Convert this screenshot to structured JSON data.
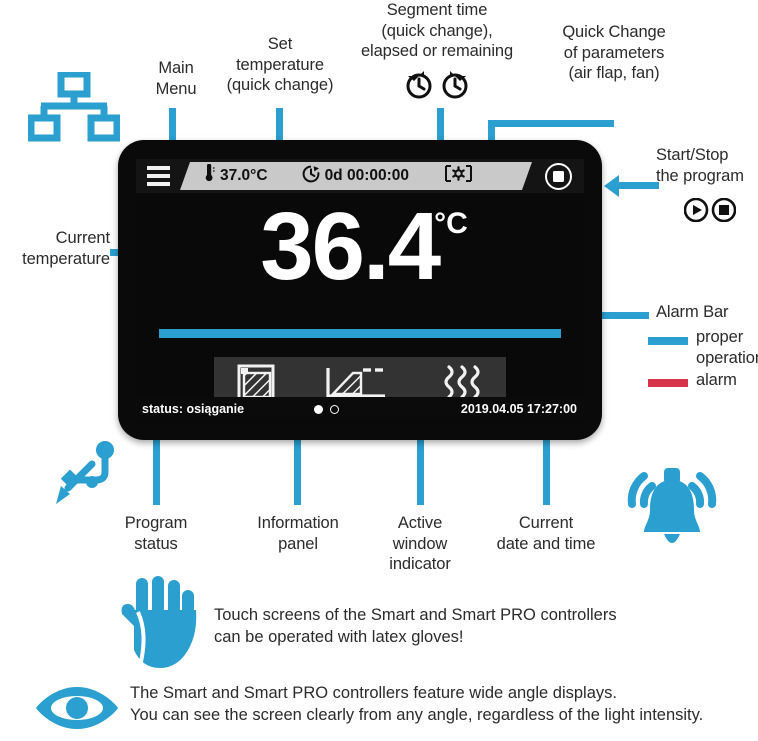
{
  "callouts": {
    "main_menu": "Main\nMenu",
    "set_temperature": "Set\ntemperature\n(quick change)",
    "segment_time": "Segment time\n(quick change),\nelapsed or remaining",
    "quick_change_params": "Quick Change\nof parameters\n(air flap, fan)",
    "start_stop": "Start/Stop\nthe program",
    "current_temperature": "Current\ntemperature",
    "alarm_bar": "Alarm Bar",
    "alarm_proper": "proper\noperation",
    "alarm_alarm": "alarm",
    "program_status": "Program\nstatus",
    "information_panel": "Information\npanel",
    "active_window_indicator": "Active\nwindow\nindicator",
    "current_date_time": "Current\ndate and time"
  },
  "device": {
    "quick_bar": {
      "set_temperature_value": "37.0°C",
      "segment_time_value": "0d 00:00:00"
    },
    "main_reading": {
      "value": "36.4",
      "unit": "°C"
    },
    "status_bar": {
      "program_status": "status: osiąganie",
      "datetime": "2019.04.05 17:27:00"
    },
    "info_panel_icons": [
      "chamber-icon",
      "program-chart-icon",
      "heating-waves-icon"
    ],
    "active_window": {
      "total": 2,
      "active_index": 0
    }
  },
  "notes": {
    "gloves": "Touch screens of the Smart and Smart PRO controllers\ncan be operated with latex gloves!",
    "viewing_angle": "The Smart  and Smart PRO controllers feature wide angle displays.\nYou can see the screen clearly from any angle, regardless of the light intensity."
  },
  "colors": {
    "accent": "#2a9fd0",
    "alarm": "#d7334a",
    "screen_bg": "#090909",
    "quick_strip": "#c9c9c9"
  }
}
